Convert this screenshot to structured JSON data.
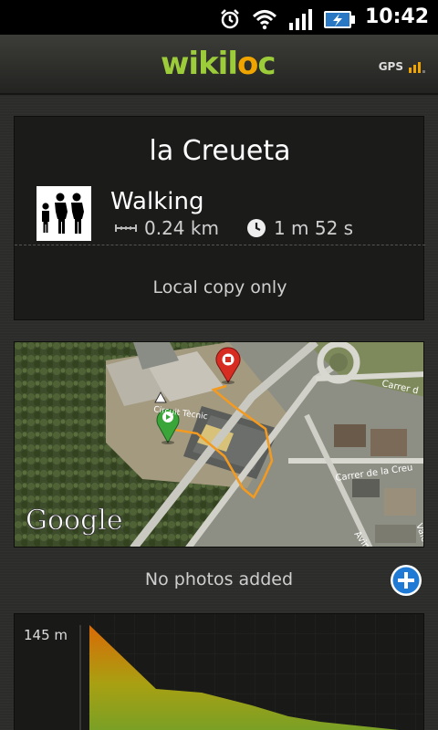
{
  "status_bar": {
    "time": "10:42",
    "icons": [
      "alarm-icon",
      "wifi-icon",
      "signal-icon",
      "battery-charging-icon"
    ]
  },
  "header": {
    "logo": {
      "part1": "wikil",
      "part2": "o",
      "part3": "c"
    },
    "gps_label": "GPS"
  },
  "trail": {
    "title": "la Creueta",
    "activity": "Walking",
    "distance": "0.24 km",
    "duration": "1 m 52 s",
    "sync_status": "Local copy only"
  },
  "map": {
    "attribution": "Google",
    "labels": {
      "street1": "Carrer de la Creu",
      "street2": "Carrer d",
      "street3": "Aving",
      "street4": "Valor",
      "poi": "Circuit Tècnic"
    },
    "start_marker": "green",
    "end_marker": "red"
  },
  "photos": {
    "empty_label": "No photos added"
  },
  "elevation": {
    "max_label": "145 m"
  },
  "colors": {
    "accent_green": "#9ccc3a",
    "accent_orange": "#f0a400",
    "add_blue": "#1f7ad6"
  }
}
